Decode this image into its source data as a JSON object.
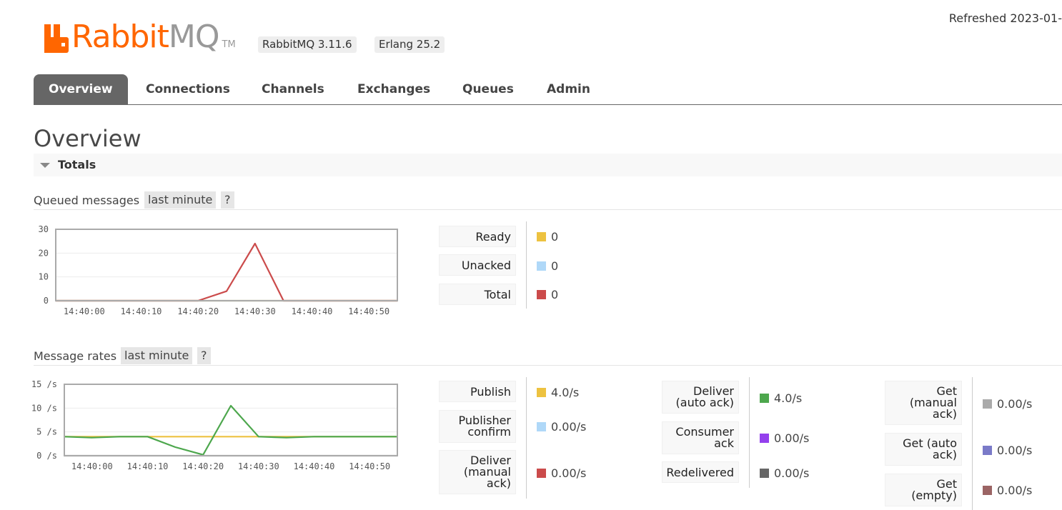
{
  "header": {
    "logo_text_a": "Rabbit",
    "logo_text_b": "MQ",
    "logo_tm": "TM",
    "version": "RabbitMQ 3.11.6",
    "erlang": "Erlang 25.2",
    "refreshed": "Refreshed 2023-01-"
  },
  "tabs": [
    "Overview",
    "Connections",
    "Channels",
    "Exchanges",
    "Queues",
    "Admin"
  ],
  "page_title": "Overview",
  "totals_section": {
    "label": "Totals"
  },
  "queued": {
    "title": "Queued messages",
    "range": "last minute",
    "help": "?",
    "legend": [
      {
        "label": "Ready",
        "value": "0",
        "color": "#edc240"
      },
      {
        "label": "Unacked",
        "value": "0",
        "color": "#afd8f8"
      },
      {
        "label": "Total",
        "value": "0",
        "color": "#cb4b4b"
      }
    ]
  },
  "rates": {
    "title": "Message rates",
    "range": "last minute",
    "help": "?",
    "col1": [
      {
        "label": "Publish",
        "value": "4.0/s",
        "color": "#edc240"
      },
      {
        "label": "Publisher confirm",
        "value": "0.00/s",
        "color": "#afd8f8"
      },
      {
        "label": "Deliver (manual ack)",
        "value": "0.00/s",
        "color": "#cb4b4b"
      }
    ],
    "col2": [
      {
        "label": "Deliver (auto ack)",
        "value": "4.0/s",
        "color": "#4da74d"
      },
      {
        "label": "Consumer ack",
        "value": "0.00/s",
        "color": "#9440ed"
      },
      {
        "label": "Redelivered",
        "value": "0.00/s",
        "color": "#666666"
      }
    ],
    "col3": [
      {
        "label": "Get (manual ack)",
        "value": "0.00/s",
        "color": "#aaaaaa"
      },
      {
        "label": "Get (auto ack)",
        "value": "0.00/s",
        "color": "#7a7ac8"
      },
      {
        "label": "Get (empty)",
        "value": "0.00/s",
        "color": "#9b6464"
      }
    ]
  },
  "chart_data": [
    {
      "type": "line",
      "x": [
        "14:39:55",
        "14:40:00",
        "14:40:05",
        "14:40:10",
        "14:40:15",
        "14:40:20",
        "14:40:25",
        "14:40:30",
        "14:40:35",
        "14:40:40",
        "14:40:45",
        "14:40:50",
        "14:40:55"
      ],
      "x_ticks": [
        "14:40:00",
        "14:40:10",
        "14:40:20",
        "14:40:30",
        "14:40:40",
        "14:40:50"
      ],
      "y_ticks": [
        "0",
        "10",
        "20",
        "30"
      ],
      "ylim": [
        0,
        30
      ],
      "grid": true,
      "series": [
        {
          "name": "Ready",
          "color": "#edc240",
          "values": [
            0,
            0,
            0,
            0,
            0,
            0,
            0,
            0,
            0,
            0,
            0,
            0,
            0
          ]
        },
        {
          "name": "Unacked",
          "color": "#afd8f8",
          "values": [
            0,
            0,
            0,
            0,
            0,
            0,
            0,
            0,
            0,
            0,
            0,
            0,
            0
          ]
        },
        {
          "name": "Total",
          "color": "#cb4b4b",
          "values": [
            0,
            0,
            0,
            0,
            0,
            0,
            4,
            24,
            0,
            0,
            0,
            0,
            0
          ]
        }
      ]
    },
    {
      "type": "line",
      "x": [
        "14:39:55",
        "14:40:00",
        "14:40:05",
        "14:40:10",
        "14:40:15",
        "14:40:20",
        "14:40:25",
        "14:40:30",
        "14:40:35",
        "14:40:40",
        "14:40:45",
        "14:40:50",
        "14:40:55"
      ],
      "x_ticks": [
        "14:40:00",
        "14:40:10",
        "14:40:20",
        "14:40:30",
        "14:40:40",
        "14:40:50"
      ],
      "y_ticks": [
        "0 /s",
        "5 /s",
        "10 /s",
        "15 /s"
      ],
      "ylim": [
        0,
        15
      ],
      "grid": true,
      "series": [
        {
          "name": "Publish",
          "color": "#edc240",
          "values": [
            4,
            4,
            4,
            4,
            4,
            4,
            4,
            4,
            4,
            4,
            4,
            4,
            4
          ]
        },
        {
          "name": "Deliver (auto ack)",
          "color": "#4da74d",
          "values": [
            4,
            3.8,
            4,
            4,
            1.8,
            0.2,
            10.5,
            4,
            3.8,
            4,
            4,
            4,
            4
          ]
        },
        {
          "name": "Get (manual ack)",
          "color": "#aaaaaa",
          "values": [
            0,
            0,
            0,
            0,
            0,
            0,
            0,
            0,
            0,
            0,
            0,
            0,
            0
          ]
        }
      ]
    }
  ]
}
